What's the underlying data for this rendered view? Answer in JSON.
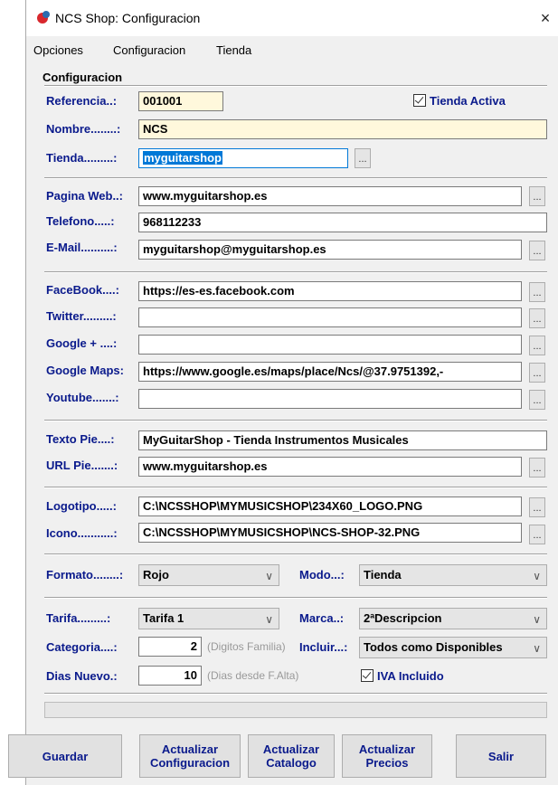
{
  "window": {
    "title": "NCS Shop: Configuracion",
    "close": "×"
  },
  "menu": [
    "Opciones",
    "Configuracion",
    "Tienda"
  ],
  "group_title": "Configuracion",
  "form": {
    "referencia_label": "Referencia..:",
    "referencia_value": "001001",
    "tienda_activa": "Tienda Activa",
    "nombre_label": "Nombre........:",
    "nombre_value": "NCS",
    "tienda_label": "Tienda.........:",
    "tienda_value": "myguitarshop",
    "pagina_label": "Pagina Web..:",
    "pagina_value": "www.myguitarshop.es",
    "telefono_label": "Telefono.....:",
    "telefono_value": "968112233",
    "email_label": "E-Mail..........:",
    "email_value": "myguitarshop@myguitarshop.es",
    "facebook_label": "FaceBook....:",
    "facebook_value": "https://es-es.facebook.com",
    "twitter_label": "Twitter.........:",
    "twitter_value": "",
    "google_label": "Google + ....:",
    "google_value": "",
    "maps_label": "Google Maps:",
    "maps_value": "https://www.google.es/maps/place/Ncs/@37.9751392,-",
    "youtube_label": "Youtube.......:",
    "youtube_value": "",
    "textopie_label": "Texto Pie....:",
    "textopie_value": "MyGuitarShop - Tienda Instrumentos Musicales",
    "urlpie_label": "URL Pie.......:",
    "urlpie_value": "www.myguitarshop.es",
    "logotipo_label": "Logotipo.....:",
    "logotipo_value": "C:\\NCSSHOP\\MYMUSICSHOP\\234X60_LOGO.PNG",
    "icono_label": "Icono...........:",
    "icono_value": "C:\\NCSSHOP\\MYMUSICSHOP\\NCS-SHOP-32.PNG",
    "formato_label": "Formato........:",
    "formato_value": "Rojo",
    "modo_label": "Modo...:",
    "modo_value": "Tienda",
    "tarifa_label": "Tarifa.........:",
    "tarifa_value": "Tarifa 1",
    "marca_label": "Marca..:",
    "marca_value": "2ªDescripcion",
    "categoria_label": "Categoria....:",
    "categoria_value": "2",
    "categoria_hint": "(Digitos Familia)",
    "incluir_label": "Incluir...:",
    "incluir_value": "Todos como Disponibles",
    "dias_label": "Dias Nuevo.:",
    "dias_value": "10",
    "dias_hint": "(Dias desde F.Alta)",
    "iva_label": "IVA Incluido",
    "ellipsis": "...",
    "arrow": "∨"
  },
  "buttons": {
    "guardar": "Guardar",
    "act_conf_1": "Actualizar",
    "act_conf_2": "Configuracion",
    "act_cat_1": "Actualizar",
    "act_cat_2": "Catalogo",
    "act_pre_1": "Actualizar",
    "act_pre_2": "Precios",
    "salir": "Salir"
  }
}
